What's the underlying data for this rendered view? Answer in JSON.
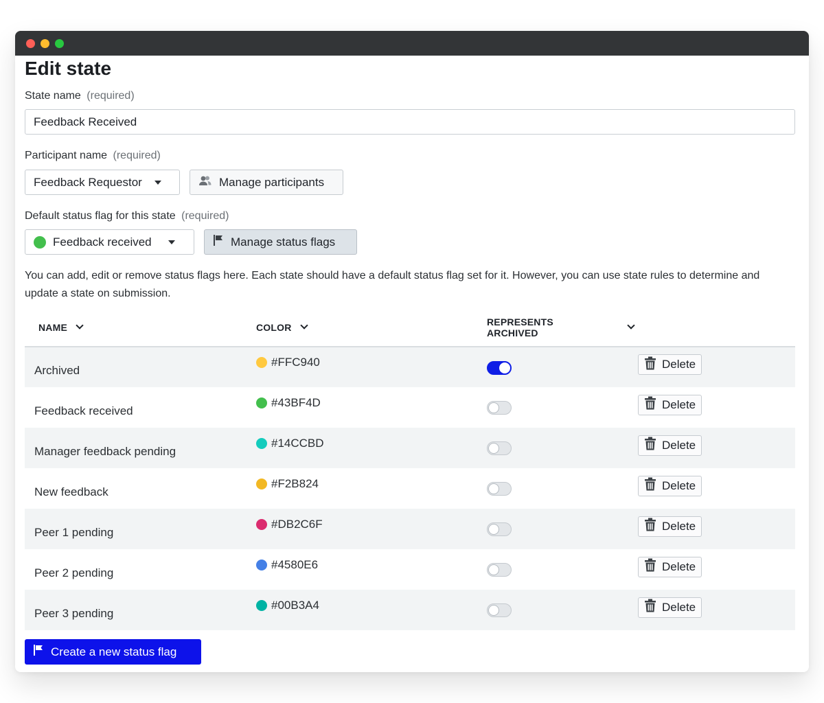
{
  "page": {
    "title": "Edit state"
  },
  "state_name": {
    "label": "State name",
    "required": "(required)",
    "value": "Feedback Received"
  },
  "participant": {
    "label": "Participant name",
    "required": "(required)",
    "selected": "Feedback Requestor",
    "manage_label": "Manage participants"
  },
  "default_flag": {
    "label": "Default status flag for this state",
    "required": "(required)",
    "selected": "Feedback received",
    "selected_color": "#43BF4D",
    "manage_label": "Manage status flags"
  },
  "help_text": "You can add, edit or remove status flags here. Each state should have a default status flag set for it. However, you can use state rules to determine and update a state on submission.",
  "table": {
    "headers": {
      "name": "NAME",
      "color": "COLOR",
      "archived": "REPRESENTS ARCHIVED"
    },
    "delete_label": "Delete",
    "rows": [
      {
        "name": "Archived",
        "color": "#FFC940",
        "archived": true
      },
      {
        "name": "Feedback received",
        "color": "#43BF4D",
        "archived": false
      },
      {
        "name": "Manager feedback pending",
        "color": "#14CCBD",
        "archived": false
      },
      {
        "name": "New feedback",
        "color": "#F2B824",
        "archived": false
      },
      {
        "name": "Peer 1 pending",
        "color": "#DB2C6F",
        "archived": false
      },
      {
        "name": "Peer 2 pending",
        "color": "#4580E6",
        "archived": false
      },
      {
        "name": "Peer 3 pending",
        "color": "#00B3A4",
        "archived": false
      }
    ]
  },
  "create_button": {
    "label": "Create a new status flag"
  },
  "colors": {
    "accent": "#0D12EA",
    "titlebar": "#333537"
  }
}
